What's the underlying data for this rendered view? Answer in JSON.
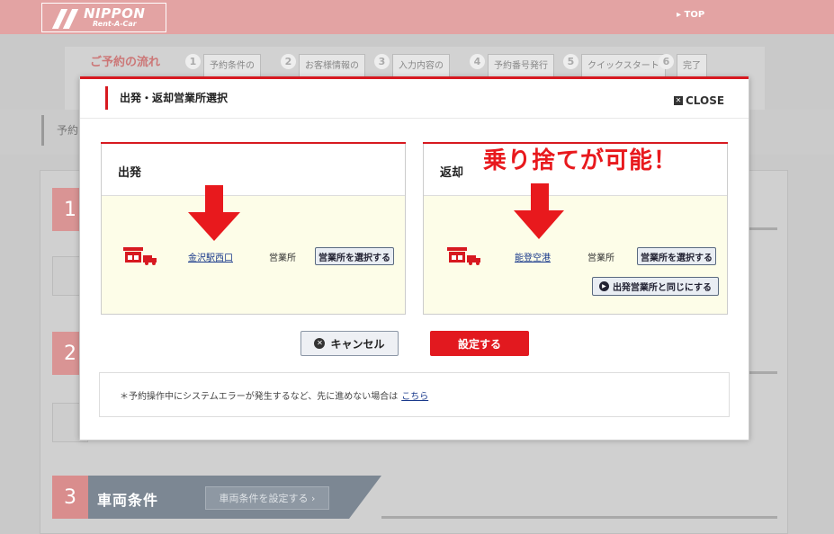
{
  "header": {
    "logo_name": "NIPPON",
    "logo_sub": "Rent-A-Car",
    "top_link": "▸ TOP"
  },
  "steps": {
    "title": "ご予約の流れ",
    "items": [
      {
        "num": "1",
        "label": "予約条件の"
      },
      {
        "num": "2",
        "label": "お客様情報の"
      },
      {
        "num": "3",
        "label": "入力内容の"
      },
      {
        "num": "4",
        "label": "予約番号発行"
      },
      {
        "num": "5",
        "label": "クイックスタート"
      },
      {
        "num": "6",
        "label": "完了"
      }
    ]
  },
  "background": {
    "band_text": "予約",
    "sections": [
      {
        "num": "1"
      },
      {
        "num": "2"
      },
      {
        "num": "3",
        "title": "車両条件",
        "button": "車両条件を設定する ›"
      }
    ]
  },
  "modal": {
    "title": "出発・返却営業所選択",
    "close_label": "CLOSE",
    "departure": {
      "heading": "出発",
      "office_name": "金沢駅西口",
      "office_suffix": "営業所",
      "select_button": "営業所を選択する"
    },
    "return": {
      "heading": "返却",
      "office_name": "能登空港",
      "office_suffix": "営業所",
      "select_button": "営業所を選択する",
      "same_button": "出発営業所と同じにする"
    },
    "callout": "乗り捨てが可能！",
    "cancel_button": "キャンセル",
    "set_button": "設定する",
    "note": "＊予約操作中にシステムエラーが発生するなど、先に進めない場合は",
    "note_link": "こちら"
  },
  "colors": {
    "accent_red": "#d71920",
    "header_pink": "#e3a3a3",
    "panel_cream": "#fdfde8",
    "link_blue": "#1a3a8c"
  }
}
